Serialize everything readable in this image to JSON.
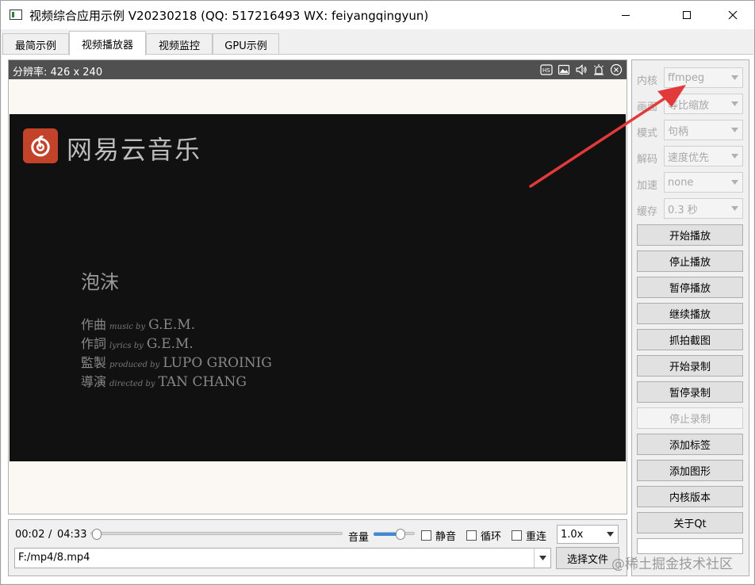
{
  "window": {
    "title": "视频综合应用示例 V20230218 (QQ: 517216493 WX: feiyangqingyun)"
  },
  "tabs": [
    {
      "label": "最简示例"
    },
    {
      "label": "视频播放器"
    },
    {
      "label": "视频监控"
    },
    {
      "label": "GPU示例"
    }
  ],
  "video": {
    "resolution_label": "分辨率: 426 x 240",
    "header_icons": [
      "hardware-decode-icon",
      "snapshot-icon",
      "volume-icon",
      "alarm-icon",
      "close-icon"
    ],
    "logo_text": "网易云音乐",
    "song_title": "泡沫",
    "credits": [
      {
        "role": "作曲",
        "tag": "music by",
        "name": "G.E.M."
      },
      {
        "role": "作詞",
        "tag": "lyrics by",
        "name": "G.E.M."
      },
      {
        "role": "監製",
        "tag": "produced by",
        "name": "LUPO GROINIG"
      },
      {
        "role": "導演",
        "tag": "directed by",
        "name": "TAN CHANG"
      }
    ]
  },
  "controls": {
    "current_time": "00:02",
    "separator": "/",
    "total_time": "04:33",
    "progress_fraction": 0.008,
    "volume_label": "音量",
    "volume_fraction": 0.7,
    "mute_label": "静音",
    "loop_label": "循环",
    "reconnect_label": "重连",
    "speed_value": "1.0x",
    "file_path": "F:/mp4/8.mp4",
    "choose_file_label": "选择文件"
  },
  "panel": {
    "settings": [
      {
        "label": "内核",
        "value": "ffmpeg"
      },
      {
        "label": "画面",
        "value": "等比缩放"
      },
      {
        "label": "模式",
        "value": "句柄"
      },
      {
        "label": "解码",
        "value": "速度优先"
      },
      {
        "label": "加速",
        "value": "none"
      },
      {
        "label": "缓存",
        "value": "0.3 秒"
      }
    ],
    "buttons": [
      {
        "label": "开始播放",
        "enabled": true
      },
      {
        "label": "停止播放",
        "enabled": true
      },
      {
        "label": "暂停播放",
        "enabled": true
      },
      {
        "label": "继续播放",
        "enabled": true
      },
      {
        "label": "抓拍截图",
        "enabled": true
      },
      {
        "label": "开始录制",
        "enabled": true
      },
      {
        "label": "暂停录制",
        "enabled": true
      },
      {
        "label": "停止录制",
        "enabled": false
      },
      {
        "label": "添加标签",
        "enabled": true
      },
      {
        "label": "添加图形",
        "enabled": true
      },
      {
        "label": "内核版本",
        "enabled": true
      },
      {
        "label": "关于Qt",
        "enabled": true
      }
    ]
  },
  "watermark": "@稀土掘金技术社区",
  "colors": {
    "annotation_arrow": "#e23a3a",
    "video_header": "#505050",
    "slider_fill": "#3d8bd6",
    "logo_red": "#c2432a"
  }
}
